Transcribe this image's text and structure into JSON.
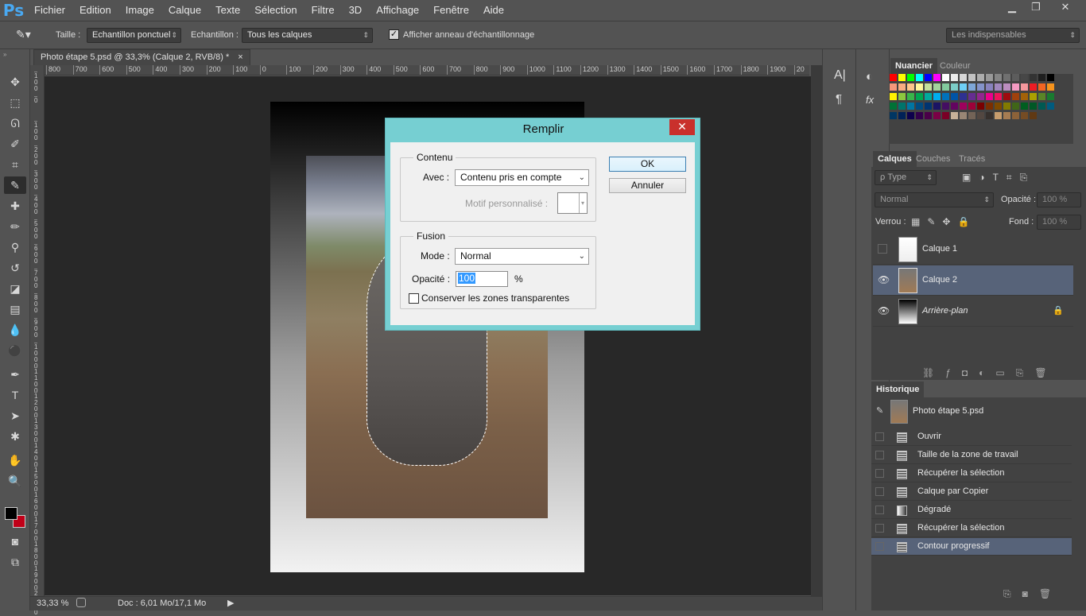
{
  "app": {
    "logo": "Ps"
  },
  "menu": [
    "Fichier",
    "Edition",
    "Image",
    "Calque",
    "Texte",
    "Sélection",
    "Filtre",
    "3D",
    "Affichage",
    "Fenêtre",
    "Aide"
  ],
  "window_controls": {
    "minimize": "▁",
    "restore": "❐",
    "close": "✕"
  },
  "options": {
    "taille_label": "Taille :",
    "taille_value": "Echantillon ponctuel",
    "echantillon_label": "Echantillon :",
    "echantillon_value": "Tous les calques",
    "show_ring_label": "Afficher anneau d'échantillonnage",
    "workspace": "Les indispensables"
  },
  "document": {
    "tab_title": "Photo étape 5.psd @ 33,3% (Calque 2, RVB/8) *",
    "tab_close": "×",
    "zoom": "33,33 %",
    "doc_info": "Doc : 6,01 Mo/17,1 Mo",
    "ruler_ticks": [
      "800",
      "700",
      "600",
      "500",
      "400",
      "300",
      "200",
      "100",
      "0",
      "100",
      "200",
      "300",
      "400",
      "500",
      "600",
      "700",
      "800",
      "900",
      "1000",
      "1100",
      "1200",
      "1300",
      "1400",
      "1500",
      "1600",
      "1700",
      "1800",
      "1900",
      "20"
    ],
    "ruler_left_ticks": [
      "1\n0\n0",
      "0",
      "1\n0\n0",
      "2\n0\n0",
      "3\n0\n0",
      "4\n0\n0",
      "5\n0\n0",
      "6\n0\n0",
      "7\n0\n0",
      "8\n0\n0",
      "9\n0\n0",
      "1\n0\n0\n0",
      "1\n1\n0\n0",
      "1\n2\n0\n0",
      "1\n3\n0\n0",
      "1\n4\n0\n0",
      "1\n5\n0\n0",
      "1\n6\n0\n0",
      "1\n7\n0\n0",
      "1\n8\n0\n0",
      "1\n9\n0\n0",
      "2\n0\n0\n0"
    ]
  },
  "swatches_panel": {
    "tabs": [
      "Nuancier",
      "Couleur"
    ]
  },
  "swatch_colors": [
    "#ff0000",
    "#ffff00",
    "#00ff00",
    "#00ffff",
    "#0000ff",
    "#ff00ff",
    "#ffffff",
    "#ebebeb",
    "#d6d6d6",
    "#c2c2c2",
    "#adadad",
    "#999999",
    "#858585",
    "#707070",
    "#5c5c5c",
    "#474747",
    "#333333",
    "#1f1f1f",
    "#000000",
    "#f7977a",
    "#f9ad81",
    "#fdc68a",
    "#fff79a",
    "#c4df9b",
    "#a3d39c",
    "#82ca9d",
    "#7bcdc8",
    "#6ecff6",
    "#7ea7d8",
    "#8493ca",
    "#8882be",
    "#a187be",
    "#bc8dbf",
    "#f49ac2",
    "#f6989d",
    "#ed1c24",
    "#f26522",
    "#f7941d",
    "#fff200",
    "#8dc73f",
    "#39b54a",
    "#00a651",
    "#00a99d",
    "#00aeef",
    "#0072bc",
    "#0054a6",
    "#2e3192",
    "#662d91",
    "#92278f",
    "#ec008c",
    "#ed145b",
    "#9e0b0f",
    "#a0410d",
    "#a36209",
    "#aba000",
    "#598527",
    "#197b30",
    "#007236",
    "#00746b",
    "#0076a3",
    "#004b80",
    "#003471",
    "#1b1464",
    "#440e62",
    "#630460",
    "#9e005d",
    "#9e0039",
    "#790000",
    "#7b2e00",
    "#7d4900",
    "#827b00",
    "#406618",
    "#005e20",
    "#005826",
    "#005952",
    "#005b7f",
    "#003663",
    "#002157",
    "#0d004c",
    "#32004b",
    "#4b0049",
    "#7b0046",
    "#7a0026",
    "#c7b299",
    "#998675",
    "#736357",
    "#534741",
    "#37302d",
    "#c69c6d",
    "#a67c52",
    "#8c6239",
    "#754c24",
    "#603913"
  ],
  "layers_panel": {
    "tabs": [
      "Calques",
      "Couches",
      "Tracés"
    ],
    "filter": "ρ Type",
    "blend_mode": "Normal",
    "opacity_label": "Opacité :",
    "opacity_value": "100 %",
    "lock_label": "Verrou :",
    "fill_label": "Fond :",
    "fill_value": "100 %",
    "layers": [
      {
        "name": "Calque 1",
        "visible": false,
        "selected": false
      },
      {
        "name": "Calque 2",
        "visible": true,
        "selected": true
      },
      {
        "name": "Arrière-plan",
        "visible": true,
        "selected": false,
        "locked": true
      }
    ]
  },
  "history_panel": {
    "tab": "Historique",
    "snapshot": "Photo étape 5.psd",
    "items": [
      "Ouvrir",
      "Taille de la zone de travail",
      "Récupérer la sélection",
      "Calque par Copier",
      "Dégradé",
      "Récupérer la sélection",
      "Contour progressif"
    ]
  },
  "dialog": {
    "title": "Remplir",
    "close": "✕",
    "contenu_group": "Contenu",
    "avec_label": "Avec :",
    "avec_value": "Contenu pris en compte",
    "motif_label": "Motif personnalisé :",
    "fusion_group": "Fusion",
    "mode_label": "Mode :",
    "mode_value": "Normal",
    "opacite_label": "Opacité :",
    "opacite_value": "100",
    "percent": "%",
    "preserve_label": "Conserver les zones transparentes",
    "ok": "OK",
    "cancel": "Annuler"
  },
  "icons": {
    "eyedropper": "eyedropper-icon",
    "move": "move-icon",
    "marquee": "marquee-icon",
    "lasso": "lasso-icon",
    "quick-select": "quick-selection-icon",
    "crop": "crop-icon",
    "heal": "healing-brush-icon",
    "brush": "brush-icon",
    "stamp": "clone-stamp-icon",
    "history-brush": "history-brush-icon",
    "eraser": "eraser-icon",
    "gradient": "gradient-icon",
    "blur": "blur-icon",
    "dodge": "dodge-icon",
    "pen": "pen-icon",
    "type": "type-icon",
    "path-select": "path-selection-icon",
    "shape": "shape-icon",
    "hand": "hand-icon",
    "zoom": "zoom-icon"
  },
  "colors": {
    "foreground": "#000000",
    "background": "#c00018",
    "dialog_frame": "#76cfd2",
    "selected_row": "#576379"
  }
}
